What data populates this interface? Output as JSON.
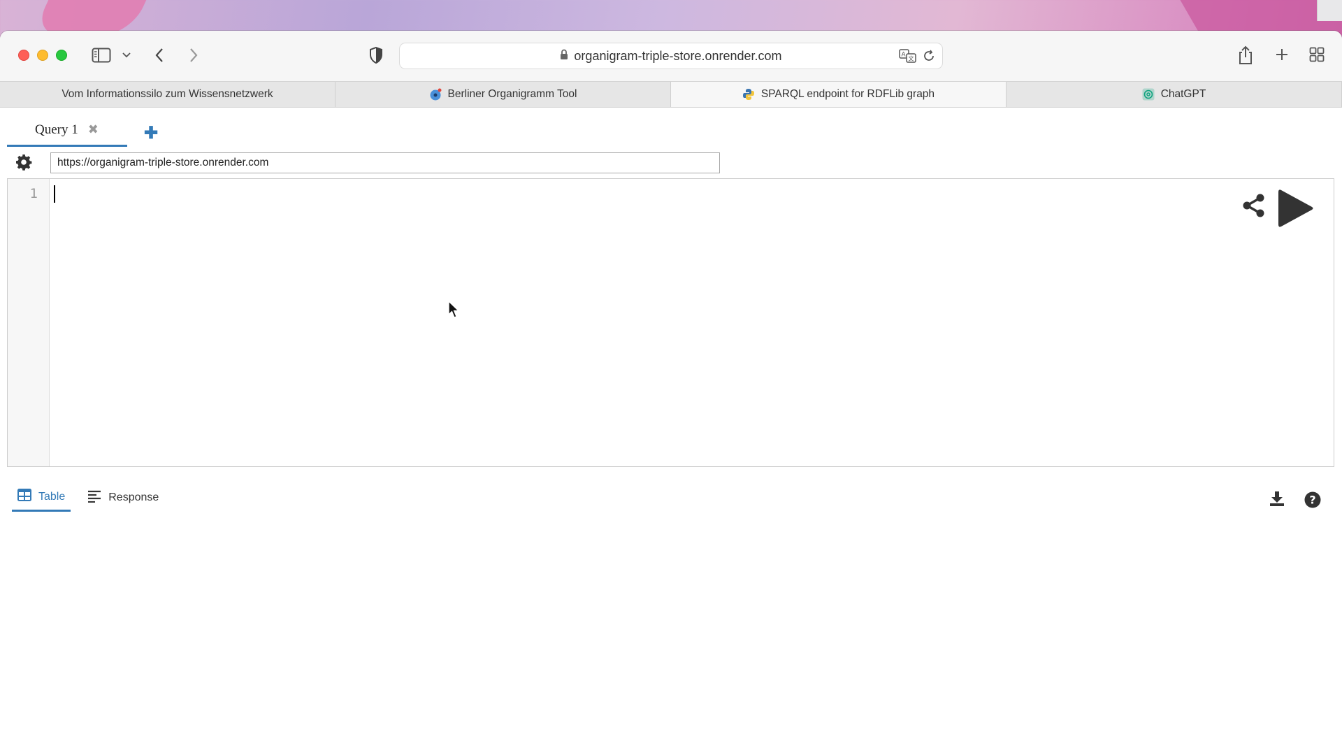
{
  "browser": {
    "url": "organigram-triple-store.onrender.com",
    "tabs": [
      {
        "label": "Vom Informationssilo zum Wissensnetzwerk",
        "favicon": "none"
      },
      {
        "label": "Berliner Organigramm Tool",
        "favicon": "blue-dot-favicon"
      },
      {
        "label": "SPARQL endpoint for RDFLib graph",
        "favicon": "python-favicon",
        "active": true
      },
      {
        "label": "ChatGPT",
        "favicon": "chatgpt-favicon"
      }
    ]
  },
  "yasgui": {
    "query_tabs": [
      {
        "label": "Query 1",
        "active": true
      }
    ],
    "endpoint_value": "https://organigram-triple-store.onrender.com",
    "editor": {
      "line_numbers": [
        "1"
      ],
      "content": ""
    },
    "result_tabs": [
      {
        "label": "Table",
        "active": true
      },
      {
        "label": "Response",
        "active": false
      }
    ]
  },
  "colors": {
    "accent": "#337ab7"
  }
}
